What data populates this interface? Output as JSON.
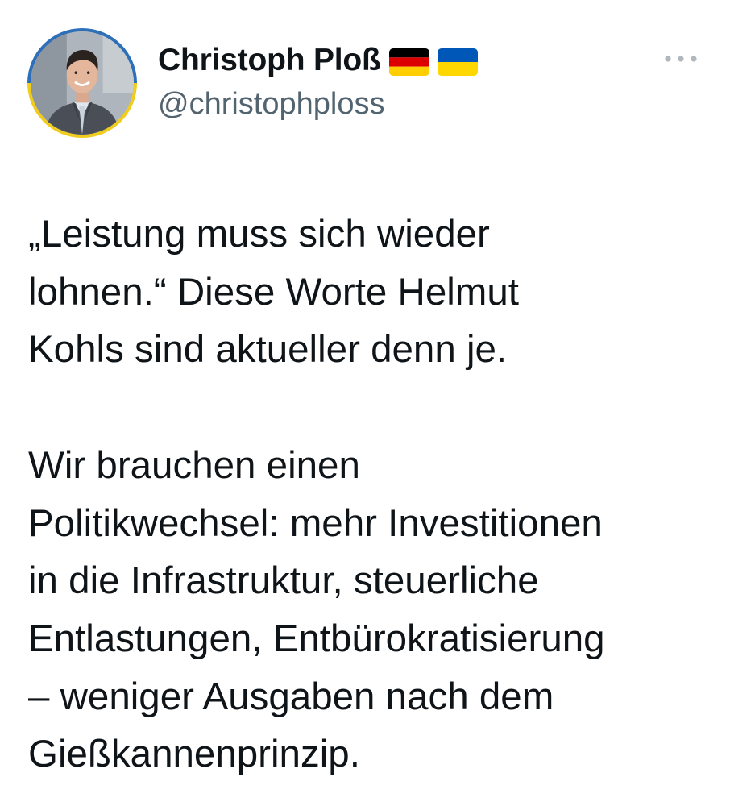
{
  "author": {
    "display_name": "Christoph Ploß",
    "flags": [
      "germany-flag",
      "ukraine-flag"
    ],
    "handle": "@christophploss",
    "avatar": "profile-photo"
  },
  "menu": {
    "icon": "more-horizontal-icon"
  },
  "tweet": {
    "paragraph1": [
      "„Leistung muss sich wieder",
      "lohnen.“ Diese Worte Helmut",
      "Kohls sind aktueller denn je."
    ],
    "paragraph2": [
      "Wir brauchen einen",
      "Politikwechsel: mehr Investitionen",
      "in die Infrastruktur, steuerliche",
      "Entlastungen, Entbürokratisierung",
      "– weniger Ausgaben nach dem",
      "Gießkannenprinzip."
    ]
  },
  "colors": {
    "text_primary": "#0f1419",
    "text_secondary": "#536471",
    "avatar_ring_top": "#2d6fb8",
    "avatar_ring_bottom": "#f0cc1c"
  }
}
